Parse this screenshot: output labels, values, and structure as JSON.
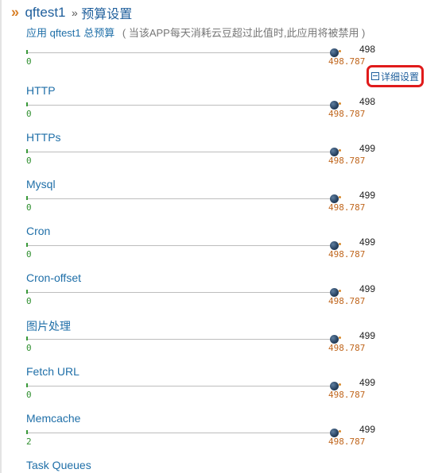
{
  "header": {
    "chevron": "»",
    "app_name": "qftest1",
    "separator": "»",
    "title": "预算设置"
  },
  "subtitle": {
    "label": "应用 qftest1 总预算",
    "note": "( 当该APP每天消耗云豆超过此值时,此应用将被禁用 )"
  },
  "detail_button": {
    "label": "详细设置",
    "icon": "minus-box-icon",
    "highlight_color": "#e01b1b"
  },
  "total_budget": {
    "min": "0",
    "max": "498.787",
    "value": "498",
    "fraction": 1.0
  },
  "rows": [
    {
      "label": "HTTP",
      "min": "0",
      "max": "498.787",
      "value": "498",
      "fraction": 1.0
    },
    {
      "label": "HTTPs",
      "min": "0",
      "max": "498.787",
      "value": "499",
      "fraction": 1.0
    },
    {
      "label": "Mysql",
      "min": "0",
      "max": "498.787",
      "value": "499",
      "fraction": 1.0
    },
    {
      "label": "Cron",
      "min": "0",
      "max": "498.787",
      "value": "499",
      "fraction": 1.0
    },
    {
      "label": "Cron-offset",
      "min": "0",
      "max": "498.787",
      "value": "499",
      "fraction": 1.0
    },
    {
      "label": "图片处理",
      "min": "0",
      "max": "498.787",
      "value": "499",
      "fraction": 1.0
    },
    {
      "label": "Fetch URL",
      "min": "0",
      "max": "498.787",
      "value": "499",
      "fraction": 1.0
    },
    {
      "label": "Memcache",
      "min": "2",
      "max": "498.787",
      "value": "499",
      "fraction": 1.0
    },
    {
      "label": "Task Queues"
    }
  ],
  "colors": {
    "link_blue": "#1f6fa8",
    "min_green": "#2f8f2f",
    "max_orange": "#c0661d",
    "chevron_orange": "#d9822b"
  }
}
